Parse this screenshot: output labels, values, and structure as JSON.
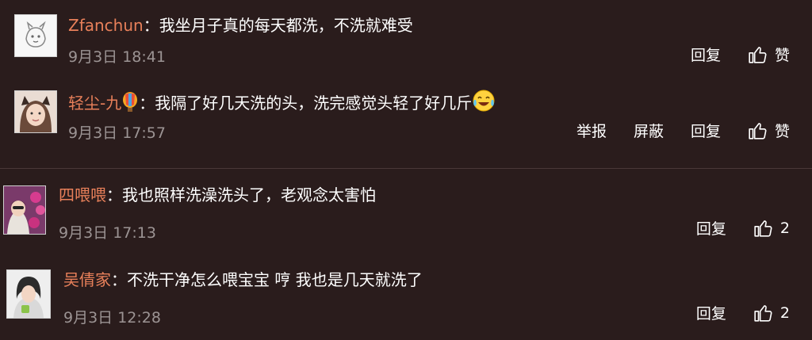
{
  "comments": [
    {
      "username": "Zfanchun",
      "separator": "：",
      "text": "我坐月子真的每天都洗，不洗就难受",
      "time": "9月3日 18:41",
      "actions": [
        "回复"
      ],
      "like_label": "赞"
    },
    {
      "username": "轻尘-九",
      "separator": "：",
      "text": "我隔了好几天洗的头，洗完感觉头轻了好几斤",
      "time": "9月3日 17:57",
      "actions": [
        "举报",
        "屏蔽",
        "回复"
      ],
      "like_label": "赞"
    },
    {
      "username": "四喂喂",
      "separator": "：",
      "text": "我也照样洗澡洗头了，老观念太害怕",
      "time": "9月3日 17:13",
      "actions": [
        "回复"
      ],
      "like_count": "2"
    },
    {
      "username": "吴倩家",
      "separator": "：",
      "text": "不洗干净怎么喂宝宝 哼 我也是几天就洗了",
      "time": "9月3日 12:28",
      "actions": [
        "回复"
      ],
      "like_count": "2"
    }
  ],
  "icons": {
    "like": "thumbs-up-icon",
    "balloon": "balloon-badge-icon",
    "emoji": "laugh-cry-emoji-icon"
  },
  "colors": {
    "background": "#2a1c1c",
    "username": "#e8805a",
    "timestamp": "#9c9494",
    "text": "#ffffff"
  }
}
